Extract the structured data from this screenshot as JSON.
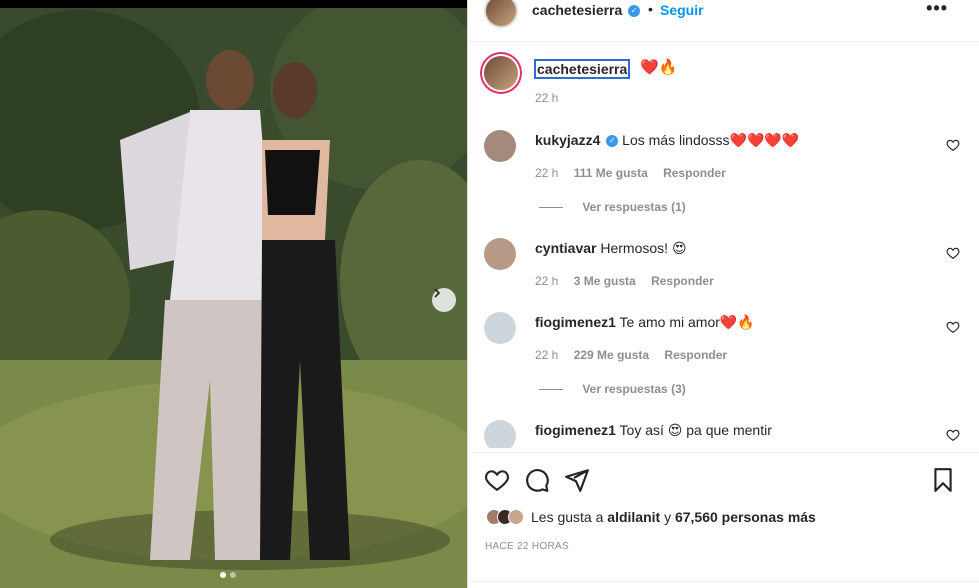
{
  "header": {
    "username": "cachetesierra",
    "separator": "•",
    "follow_label": "Seguir",
    "more_label": "•••"
  },
  "caption": {
    "username": "cachetesierra",
    "text": "❤️🔥",
    "time": "22 h"
  },
  "comments": [
    {
      "username": "kukyjazz4",
      "verified": true,
      "text": "Los más lindosss❤️❤️❤️❤️",
      "time": "22 h",
      "likes": "111 Me gusta",
      "reply_label": "Responder",
      "view_replies": "Ver respuestas (1)",
      "avatar_color": "#a48a7a"
    },
    {
      "username": "cyntiavar",
      "verified": false,
      "text": "Hermosos! 😍",
      "time": "22 h",
      "likes": "3 Me gusta",
      "reply_label": "Responder",
      "view_replies": "",
      "avatar_color": "#b79a86"
    },
    {
      "username": "fiogimenez1",
      "verified": false,
      "text": "Te amo mi amor❤️🔥",
      "time": "22 h",
      "likes": "229 Me gusta",
      "reply_label": "Responder",
      "view_replies": "Ver respuestas (3)",
      "avatar_color": "#cdd5dc"
    },
    {
      "username": "fiogimenez1",
      "verified": false,
      "text": "Toy así 😍 pa que mentir",
      "time": "",
      "likes": "",
      "reply_label": "",
      "view_replies": "",
      "avatar_color": "#cdd5dc"
    }
  ],
  "likes": {
    "prefix": "Les gusta a",
    "first_user": "aldilanit",
    "middle": "y",
    "others": "67,560 personas más"
  },
  "time_ago": "HACE 22 HORAS",
  "colors": {
    "accent": "#0095f6",
    "verified": "#3897f0",
    "heart": "#ed4956"
  },
  "icons": [
    "heart-icon",
    "comment-icon",
    "share-icon",
    "bookmark-icon",
    "chevron-right-icon",
    "more-icon"
  ]
}
